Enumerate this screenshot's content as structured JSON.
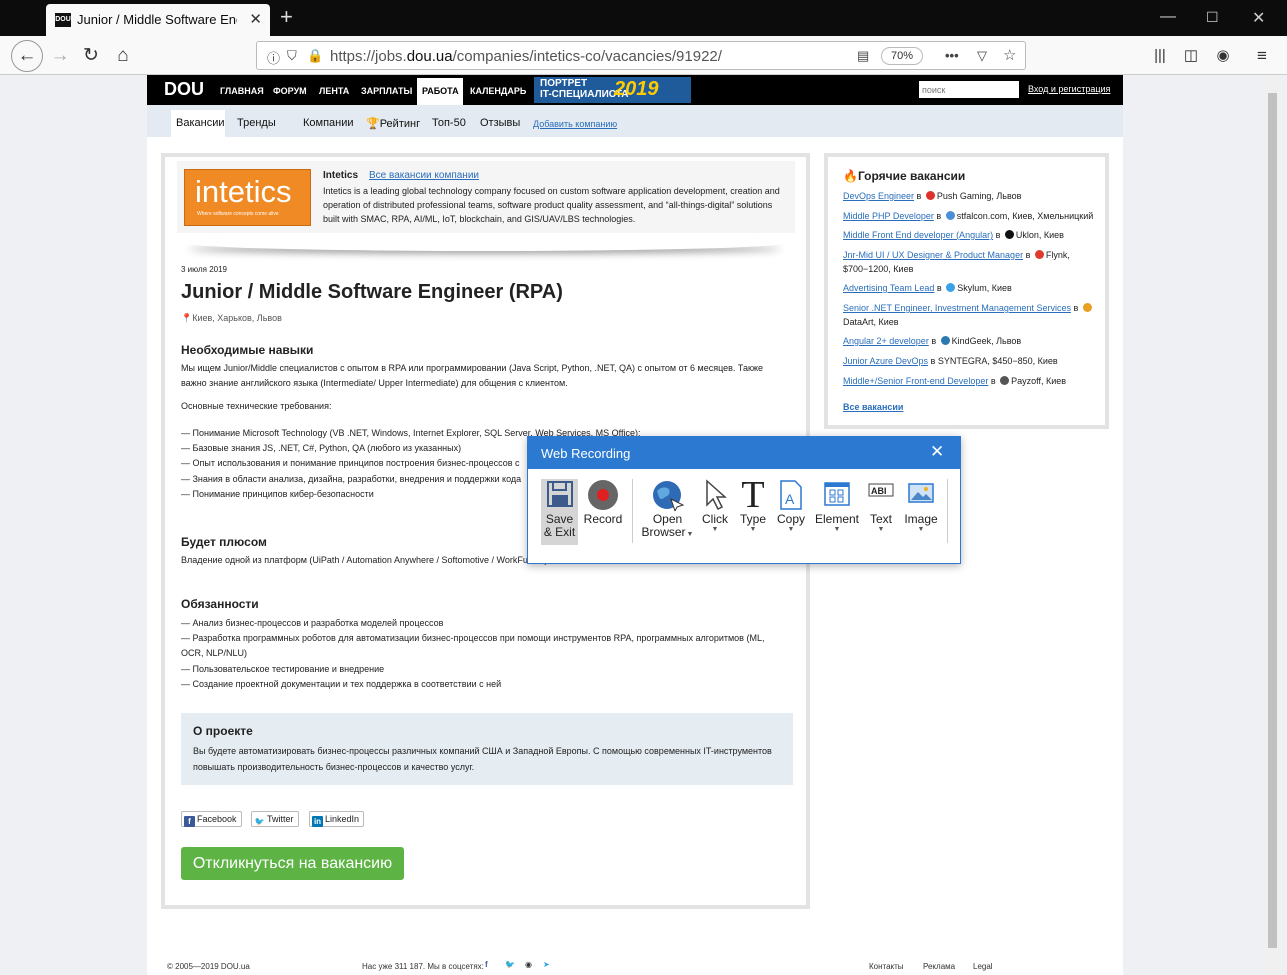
{
  "browser": {
    "tab_title": "Junior / Middle Software Engin",
    "favicon": "DOU",
    "url_prefix": "https://jobs.",
    "url_domain": "dou.ua",
    "url_path": "/companies/intetics-co/vacancies/91922/",
    "zoom": "70%"
  },
  "site": {
    "logo": "DOU",
    "nav": [
      "ГЛАВНАЯ",
      "ФОРУМ",
      "ЛЕНТА",
      "ЗАРПЛАТЫ",
      "РАБОТА",
      "КАЛЕНДАРЬ"
    ],
    "banner_line1": "ПОРТРЕТ",
    "banner_line2": "IT-СПЕЦИАЛИСТА",
    "banner_year": "2019",
    "search_placeholder": "поиск",
    "login": "Вход и регистрация",
    "subnav": [
      "Вакансии",
      "Тренды",
      "Компании",
      "Рейтинг",
      "Топ-50",
      "Отзывы",
      "Добавить компанию"
    ]
  },
  "company": {
    "logo_text": "intetics",
    "logo_slogan": "Where software concepts come alive",
    "name": "Intetics",
    "all_vacancies": "Все вакансии компании",
    "description": "Intetics is a leading global technology company focused on custom software application development, creation and operation of distributed professional teams, software product quality assessment, and “all-things-digital” solutions built with SMAC, RPA, AI/ML, IoT, blockchain, and GIS/UAV/LBS technologies."
  },
  "vacancy": {
    "date": "3 июля 2019",
    "title": "Junior / Middle Software Engineer (RPA)",
    "location": "Киев, Харьков, Львов",
    "skills_heading": "Необходимые навыки",
    "skills_text": "Мы ищем Junior/Middle специалистов с опытом в RPA или программировании (Java Script, Python, .NET, QA) с опытом от 6 месяцев. Также важно знание английского языка (Intermediate/ Upper Intermediate) для общения с клиентом.",
    "tech_req": "Основные технические требования:",
    "req1": "— Понимание Microsoft Technology (VB .NET, Windows, Internet Explorer, SQL Server, Web Services, MS Office);",
    "req2": "— Базовые знания JS, .NET, C#, Python, QA (любого из указанных)",
    "req3": "— Опыт использования и понимание принципов построения бизнес-процессов с",
    "req4": "— Знания в области анализа, дизайна, разработки, внедрения и поддержки кода",
    "req5": "— Понимание принципов кибер-безопасности",
    "plus_heading": "Будет плюсом",
    "plus_text": "Владение одной из платформ (UiPath / Automation Anywhere / Softomotive / WorkFusion)",
    "duties_heading": "Обязанности",
    "duty1": "— Анализ бизнес-процессов и разработка моделей процессов",
    "duty2": "— Разработка программных роботов для автоматизации бизнес-процессов при помощи инструментов RPA, программных алгоритмов (ML, OCR, NLP/NLU)",
    "duty3": "— Пользовательское тестирование и внедрение",
    "duty4": "— Создание проектной документации и тех поддержка в соответствии с ней",
    "project_heading": "О проекте",
    "project_text": "Вы будете автоматизировать бизнес-процессы различных компаний США и Западной Европы. С помощью современных IT-инструментов повышать производительность бизнес-процессов и качество услуг.",
    "share": [
      "Facebook",
      "Twitter",
      "LinkedIn"
    ],
    "apply": "Откликнуться на вакансию"
  },
  "hot": {
    "heading": "Горячие вакансии",
    "items": [
      {
        "link": "DevOps Engineer",
        "rest": " в ",
        "company": "Push Gaming",
        "city": ", Львов",
        "color": "#e0302b"
      },
      {
        "link": "Middle PHP Developer",
        "rest": " в ",
        "company": "stfalcon.com",
        "city": ", Киев, Хмельницкий",
        "color": "#4a90d9"
      },
      {
        "link": "Middle Front End developer (Angular)",
        "rest": " в ",
        "company": "Uklon",
        "city": ", Киев",
        "color": "#111111"
      },
      {
        "link": "Jnr-Mid UI / UX Designer & Product Manager",
        "rest": " в ",
        "company": "Flynk",
        "city": ", $700−1200, Киев",
        "color": "#e03a2f"
      },
      {
        "link": "Advertising Team Lead",
        "rest": " в ",
        "company": "Skylum",
        "city": ", Киев",
        "color": "#3aa0e8"
      },
      {
        "link": "Senior .NET Engineer, Investment Management Services",
        "rest": " в ",
        "company": "DataArt",
        "city": ", Киев",
        "color": "#e8a020"
      },
      {
        "link": "Angular 2+ developer",
        "rest": " в ",
        "company": "KindGeek",
        "city": ", Львов",
        "color": "#2a7ab0"
      },
      {
        "link": "Junior Azure DevOps",
        "rest": " в ",
        "company": "SYNTEGRA",
        "city": ", $450−850, Киев",
        "color": ""
      },
      {
        "link": "Middle+/Senior Front-end Developer",
        "rest": " в ",
        "company": "Payzoff",
        "city": ", Киев",
        "color": "#555555"
      }
    ],
    "all": "Все вакансии"
  },
  "footer": {
    "copy": "© 2005—2019 DOU.ua",
    "social": "Нас уже 311 187. Мы в соцсетях:",
    "links": [
      "Контакты",
      "Реклама",
      "Legal"
    ]
  },
  "recorder": {
    "title": "Web Recording",
    "buttons": {
      "save": "Save & Exit",
      "record": "Record",
      "browser": "Open Browser",
      "click": "Click",
      "type": "Type",
      "copy": "Copy",
      "element": "Element",
      "text": "Text",
      "image": "Image"
    }
  }
}
